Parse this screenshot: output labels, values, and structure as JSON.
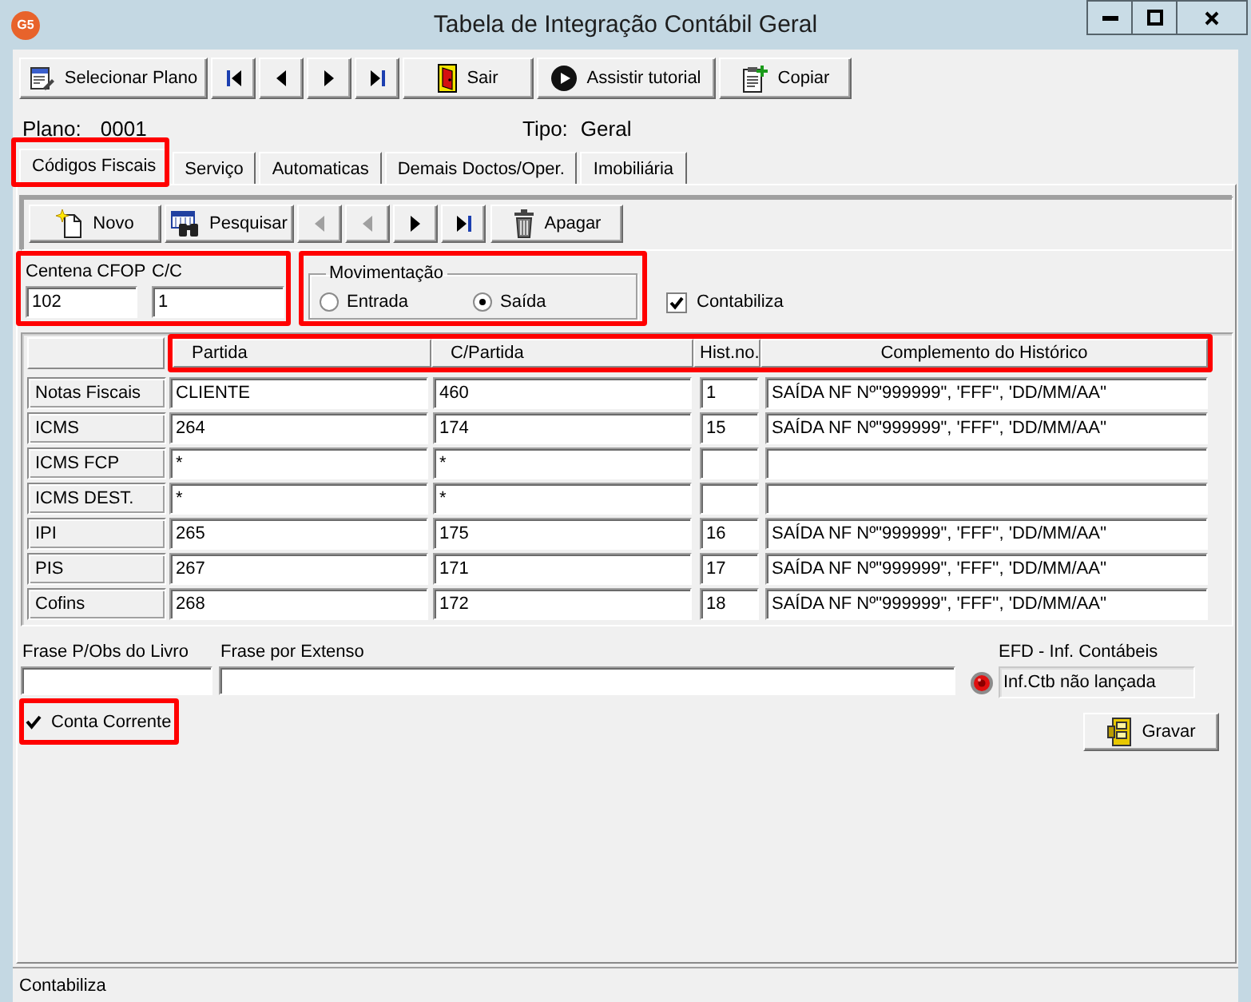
{
  "window": {
    "logo": "G5",
    "title": "Tabela de Integração Contábil Geral"
  },
  "toolbar": [
    {
      "kind": "plan",
      "label": "Selecionar Plano"
    },
    {
      "kind": "first"
    },
    {
      "kind": "prev"
    },
    {
      "kind": "next"
    },
    {
      "kind": "last"
    },
    {
      "kind": "exit",
      "label": "Sair"
    },
    {
      "kind": "tutorial",
      "label": "Assistir tutorial"
    },
    {
      "kind": "copy",
      "label": "Copiar"
    }
  ],
  "plan": {
    "label": "Plano:",
    "value": "0001"
  },
  "type": {
    "label": "Tipo:",
    "value": "Geral"
  },
  "tabs": [
    {
      "label": "Códigos Fiscais",
      "selected": true,
      "highlighted": true
    },
    {
      "label": "Serviço",
      "selected": false,
      "highlighted": false
    },
    {
      "label": "Automaticas",
      "selected": false,
      "highlighted": false
    },
    {
      "label": "Demais Doctos/Oper.",
      "selected": false,
      "highlighted": false
    },
    {
      "label": "Imobiliária",
      "selected": false,
      "highlighted": false
    }
  ],
  "record_toolbar": [
    {
      "kind": "new",
      "label": "Novo",
      "disabled": false
    },
    {
      "kind": "search",
      "label": "Pesquisar",
      "disabled": false
    },
    {
      "kind": "prev",
      "disabled": true
    },
    {
      "kind": "prev",
      "disabled": true
    },
    {
      "kind": "next",
      "disabled": false
    },
    {
      "kind": "last",
      "disabled": false
    },
    {
      "kind": "delete",
      "label": "Apagar",
      "disabled": false
    }
  ],
  "code_fields": {
    "highlighted": true,
    "fields": [
      {
        "label": "Centena CFOP",
        "value": "102"
      },
      {
        "label": "C/C",
        "value": "1"
      }
    ]
  },
  "movement": {
    "title": "Movimentação",
    "highlighted": true,
    "options": [
      {
        "label": "Entrada",
        "selected": false
      },
      {
        "label": "Saída",
        "selected": true
      }
    ]
  },
  "contabiliza": {
    "label": "Contabiliza",
    "checked": true
  },
  "grid": {
    "header_highlighted": true,
    "columns": [
      "Partida",
      "C/Partida",
      "Hist.no.",
      "Complemento do Histórico"
    ],
    "rows": [
      {
        "label": "Notas Fiscais",
        "cells": [
          "CLIENTE",
          "460",
          "1",
          "SAÍDA NF Nº\"999999\", 'FFF'', 'DD/MM/AA''"
        ]
      },
      {
        "label": "ICMS",
        "cells": [
          "264",
          "174",
          "15",
          "SAÍDA NF Nº\"999999\", 'FFF'', 'DD/MM/AA''"
        ]
      },
      {
        "label": "ICMS FCP",
        "cells": [
          "*",
          "*"
        ]
      },
      {
        "label": "ICMS DEST.",
        "cells": [
          "*",
          "*"
        ]
      },
      {
        "label": "IPI",
        "cells": [
          "265",
          "175",
          "16",
          "SAÍDA NF Nº\"999999\", 'FFF'', 'DD/MM/AA''"
        ]
      },
      {
        "label": "PIS",
        "cells": [
          "267",
          "171",
          "17",
          "SAÍDA NF Nº\"999999\", 'FFF'', 'DD/MM/AA''"
        ]
      },
      {
        "label": "Cofins",
        "cells": [
          "268",
          "172",
          "18",
          "SAÍDA NF Nº\"999999\", 'FFF'', 'DD/MM/AA''"
        ]
      }
    ]
  },
  "phrase_fields": [
    {
      "label": "Frase P/Obs do Livro"
    },
    {
      "label": "Frase por Extenso"
    }
  ],
  "efd": {
    "label": "EFD - Inf. Contábeis",
    "value": "Inf.Ctb não lançada"
  },
  "conta_corrente": {
    "label": "Conta Corrente",
    "checked": true,
    "highlighted": true
  },
  "save_button": {
    "label": "Gravar"
  },
  "status_bar": {
    "text": "Contabiliza"
  }
}
